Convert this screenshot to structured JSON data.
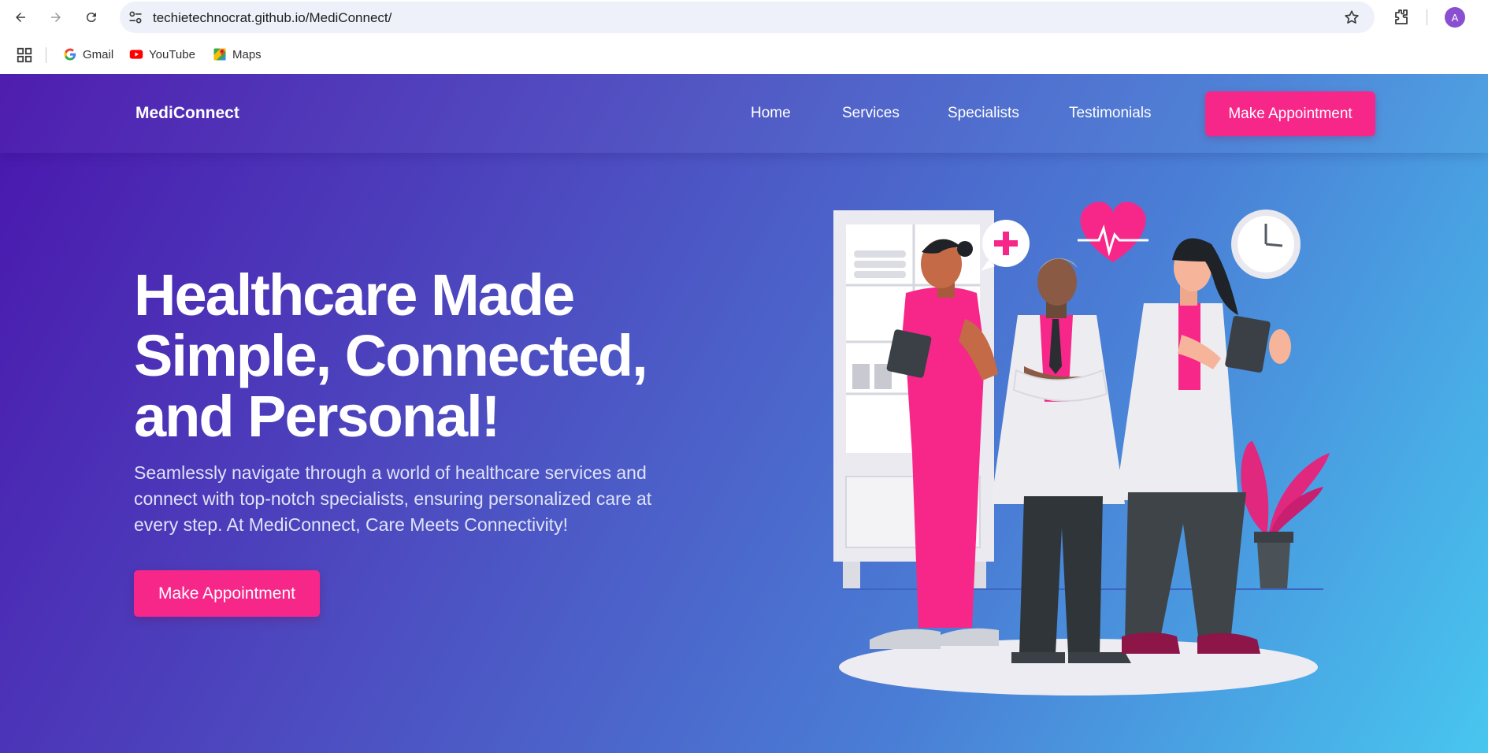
{
  "browser": {
    "url": "techietechnocrat.github.io/MediConnect/",
    "profile_initial": "A",
    "bookmarks": [
      {
        "label": "Gmail",
        "icon": "gmail-icon"
      },
      {
        "label": "YouTube",
        "icon": "youtube-icon"
      },
      {
        "label": "Maps",
        "icon": "maps-icon"
      }
    ]
  },
  "site": {
    "brand": "MediConnect",
    "nav": [
      {
        "label": "Home"
      },
      {
        "label": "Services"
      },
      {
        "label": "Specialists"
      },
      {
        "label": "Testimonials"
      }
    ],
    "nav_cta": "Make Appointment"
  },
  "hero": {
    "title_lines": [
      "Healthcare Made",
      "Simple, Connected,",
      "and Personal!"
    ],
    "subtitle_lines": [
      "Seamlessly navigate through a world of healthcare services and",
      "connect with top-notch specialists, ensuring personalized care at",
      "every step. At MediConnect, Care Meets Connectivity!"
    ],
    "cta": "Make Appointment",
    "illustration": "doctors-team-illustration"
  },
  "colors": {
    "accent": "#f7278a",
    "gradient_start": "#4a16ad",
    "gradient_end": "#48c6ef"
  }
}
